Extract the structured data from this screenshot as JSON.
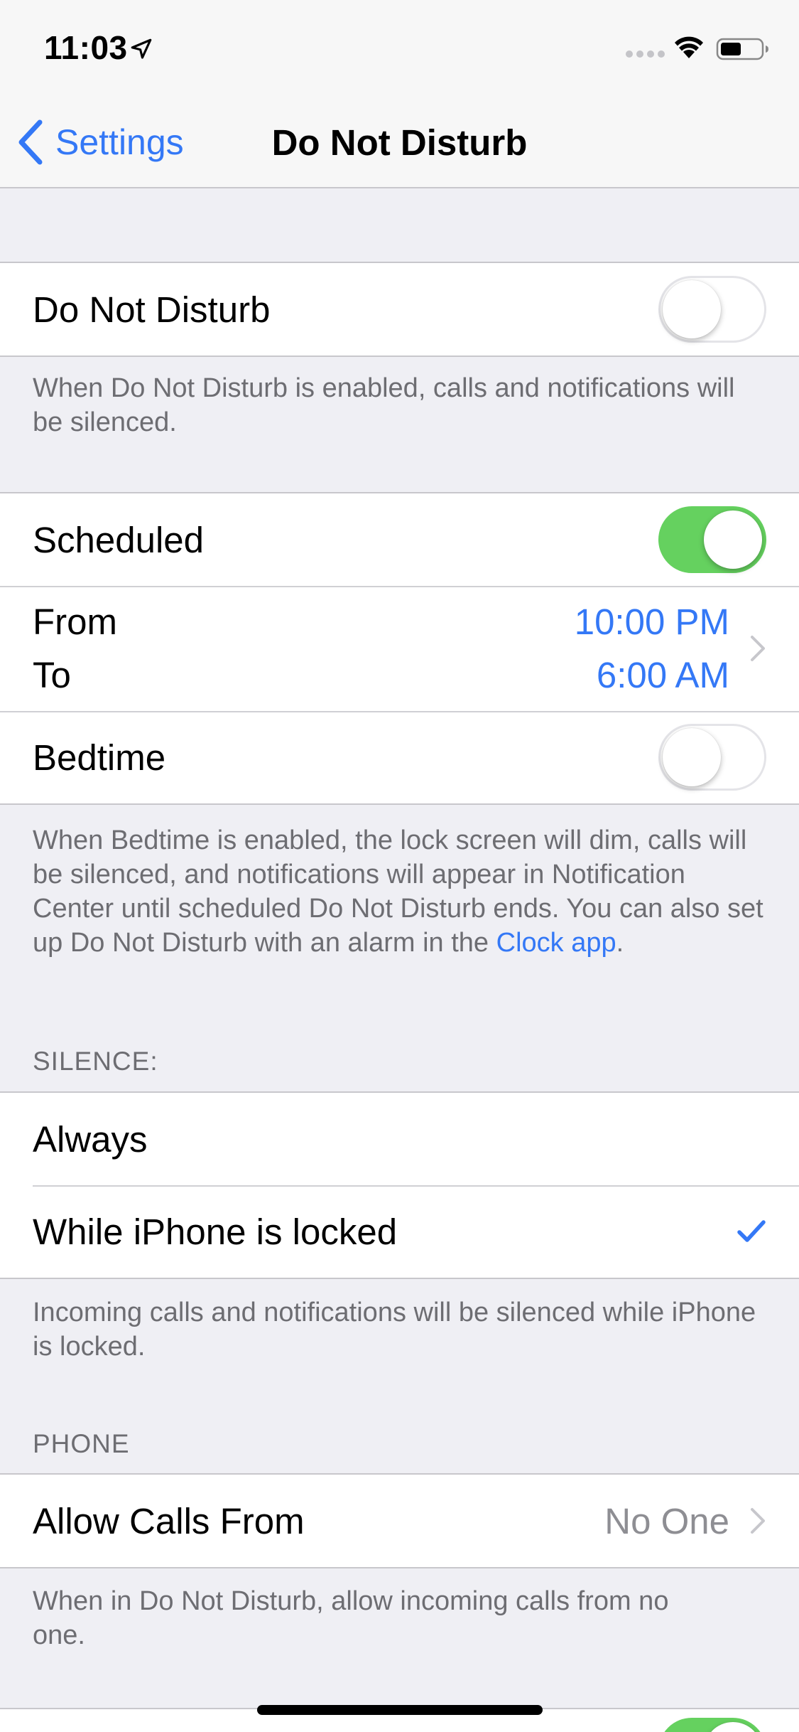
{
  "status_bar": {
    "time": "11:03"
  },
  "nav": {
    "back_label": "Settings",
    "title": "Do Not Disturb"
  },
  "dnd": {
    "label": "Do Not Disturb",
    "enabled": false,
    "footer": "When Do Not Disturb is enabled, calls and notifications will be silenced."
  },
  "schedule": {
    "scheduled_label": "Scheduled",
    "scheduled_enabled": true,
    "from_label": "From",
    "to_label": "To",
    "from_value": "10:00 PM",
    "to_value": "6:00 AM",
    "bedtime_label": "Bedtime",
    "bedtime_enabled": false,
    "footer_text": "When Bedtime is enabled, the lock screen will dim, calls will be silenced, and notifications will appear in Notification Center until scheduled Do Not Disturb ends. You can also set up Do Not Disturb with an alarm in the ",
    "footer_link": "Clock app",
    "footer_end": "."
  },
  "silence": {
    "header": "SILENCE:",
    "options": [
      {
        "label": "Always",
        "selected": false
      },
      {
        "label": "While iPhone is locked",
        "selected": true
      }
    ],
    "footer": "Incoming calls and notifications will be silenced while iPhone is locked."
  },
  "phone": {
    "header": "PHONE",
    "allow_calls_label": "Allow Calls From",
    "allow_calls_value": "No One",
    "footer": "When in Do Not Disturb, allow incoming calls from no one."
  },
  "colors": {
    "accent": "#3478f6",
    "toggle_on": "#65d15f",
    "background": "#efeff4"
  }
}
